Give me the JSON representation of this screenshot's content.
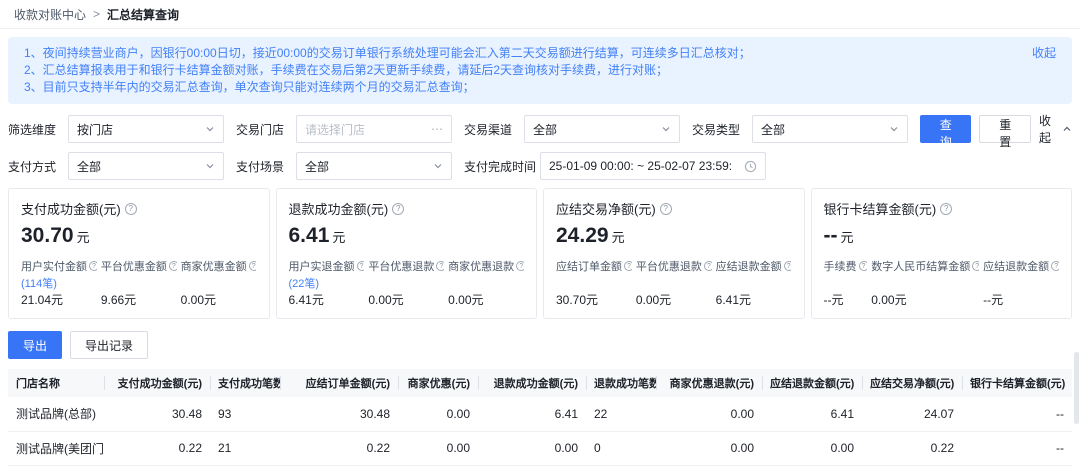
{
  "colors": {
    "primary": "#3874F6",
    "banner_bg": "#E9F2FF",
    "banner_text": "#4381F8"
  },
  "icons": {
    "help": "?",
    "more": "⋯"
  },
  "breadcrumb": {
    "root": "收款对账中心",
    "separator": ">",
    "current": "汇总结算查询"
  },
  "notice": {
    "lines": [
      "1、夜间持续营业商户，因银行00:00日切，接近00:00的交易订单银行系统处理可能会汇入第二天交易额进行结算，可连续多日汇总核对；",
      "2、汇总结算报表用于和银行卡结算金额对账，手续费在交易后第2天更新手续费，请延后2天查询核对手续费，进行对账；",
      "3、目前只支持半年内的交易汇总查询，单次查询只能对连续两个月的交易汇总查询；"
    ],
    "collapse_label": "收起"
  },
  "filters": {
    "row1": [
      {
        "label": "筛选维度",
        "value": "按门店"
      },
      {
        "label": "交易门店",
        "placeholder": "请选择门店"
      },
      {
        "label": "交易渠道",
        "value": "全部"
      },
      {
        "label": "交易类型",
        "value": "全部"
      }
    ],
    "row2": [
      {
        "label": "支付方式",
        "value": "全部"
      },
      {
        "label": "支付场景",
        "value": "全部"
      },
      {
        "label": "支付完成时间",
        "value": "25-01-09 00:00: ~ 25-02-07 23:59:"
      }
    ],
    "search_label": "查询",
    "reset_label": "重置",
    "collapse_label": "收起"
  },
  "cards": [
    {
      "title": "支付成功金额(元)",
      "amount": "30.70",
      "unit": "元",
      "count": "(114笔)",
      "subs": [
        {
          "label": "用户实付金额",
          "value": "21.04元"
        },
        {
          "label": "平台优惠金额",
          "value": "9.66元"
        },
        {
          "label": "商家优惠金额",
          "value": "0.00元"
        }
      ]
    },
    {
      "title": "退款成功金额(元)",
      "amount": "6.41",
      "unit": "元",
      "count": "(22笔)",
      "subs": [
        {
          "label": "用户实退金额",
          "value": "6.41元"
        },
        {
          "label": "平台优惠退款",
          "value": "0.00元"
        },
        {
          "label": "商家优惠退款",
          "value": "0.00元"
        }
      ]
    },
    {
      "title": "应结交易净额(元)",
      "amount": "24.29",
      "unit": "元",
      "count": "",
      "subs": [
        {
          "label": "应结订单金额",
          "value": "30.70元"
        },
        {
          "label": "平台优惠退款",
          "value": "0.00元"
        },
        {
          "label": "应结退款金额",
          "value": "6.41元"
        }
      ]
    },
    {
      "title": "银行卡结算金额(元)",
      "amount": "--",
      "unit": "元",
      "count": "",
      "subs": [
        {
          "label": "手续费",
          "value": "--元"
        },
        {
          "label": "数字人民币结算金额",
          "value": "0.00元"
        },
        {
          "label": "应结退款金额",
          "value": "--元"
        }
      ]
    }
  ],
  "actions": {
    "export": "导出",
    "export_records": "导出记录"
  },
  "table": {
    "columns": [
      "门店名称",
      "支付成功金额(元)",
      "支付成功笔数",
      "应结订单金额(元)",
      "商家优惠(元)",
      "退款成功金额(元)",
      "退款成功笔数",
      "商家优惠退款(元)",
      "应结退款金额(元)",
      "应结交易净额(元)",
      "银行卡结算金额(元)"
    ],
    "rows": [
      [
        "测试品牌(总部)",
        "30.48",
        "93",
        "30.48",
        "0.00",
        "6.41",
        "22",
        "0.00",
        "6.41",
        "24.07",
        "--"
      ],
      [
        "测试品牌(美团门店)",
        "0.22",
        "21",
        "0.22",
        "0.00",
        "0.00",
        "0",
        "0.00",
        "0.00",
        "0.22",
        "--"
      ]
    ]
  }
}
